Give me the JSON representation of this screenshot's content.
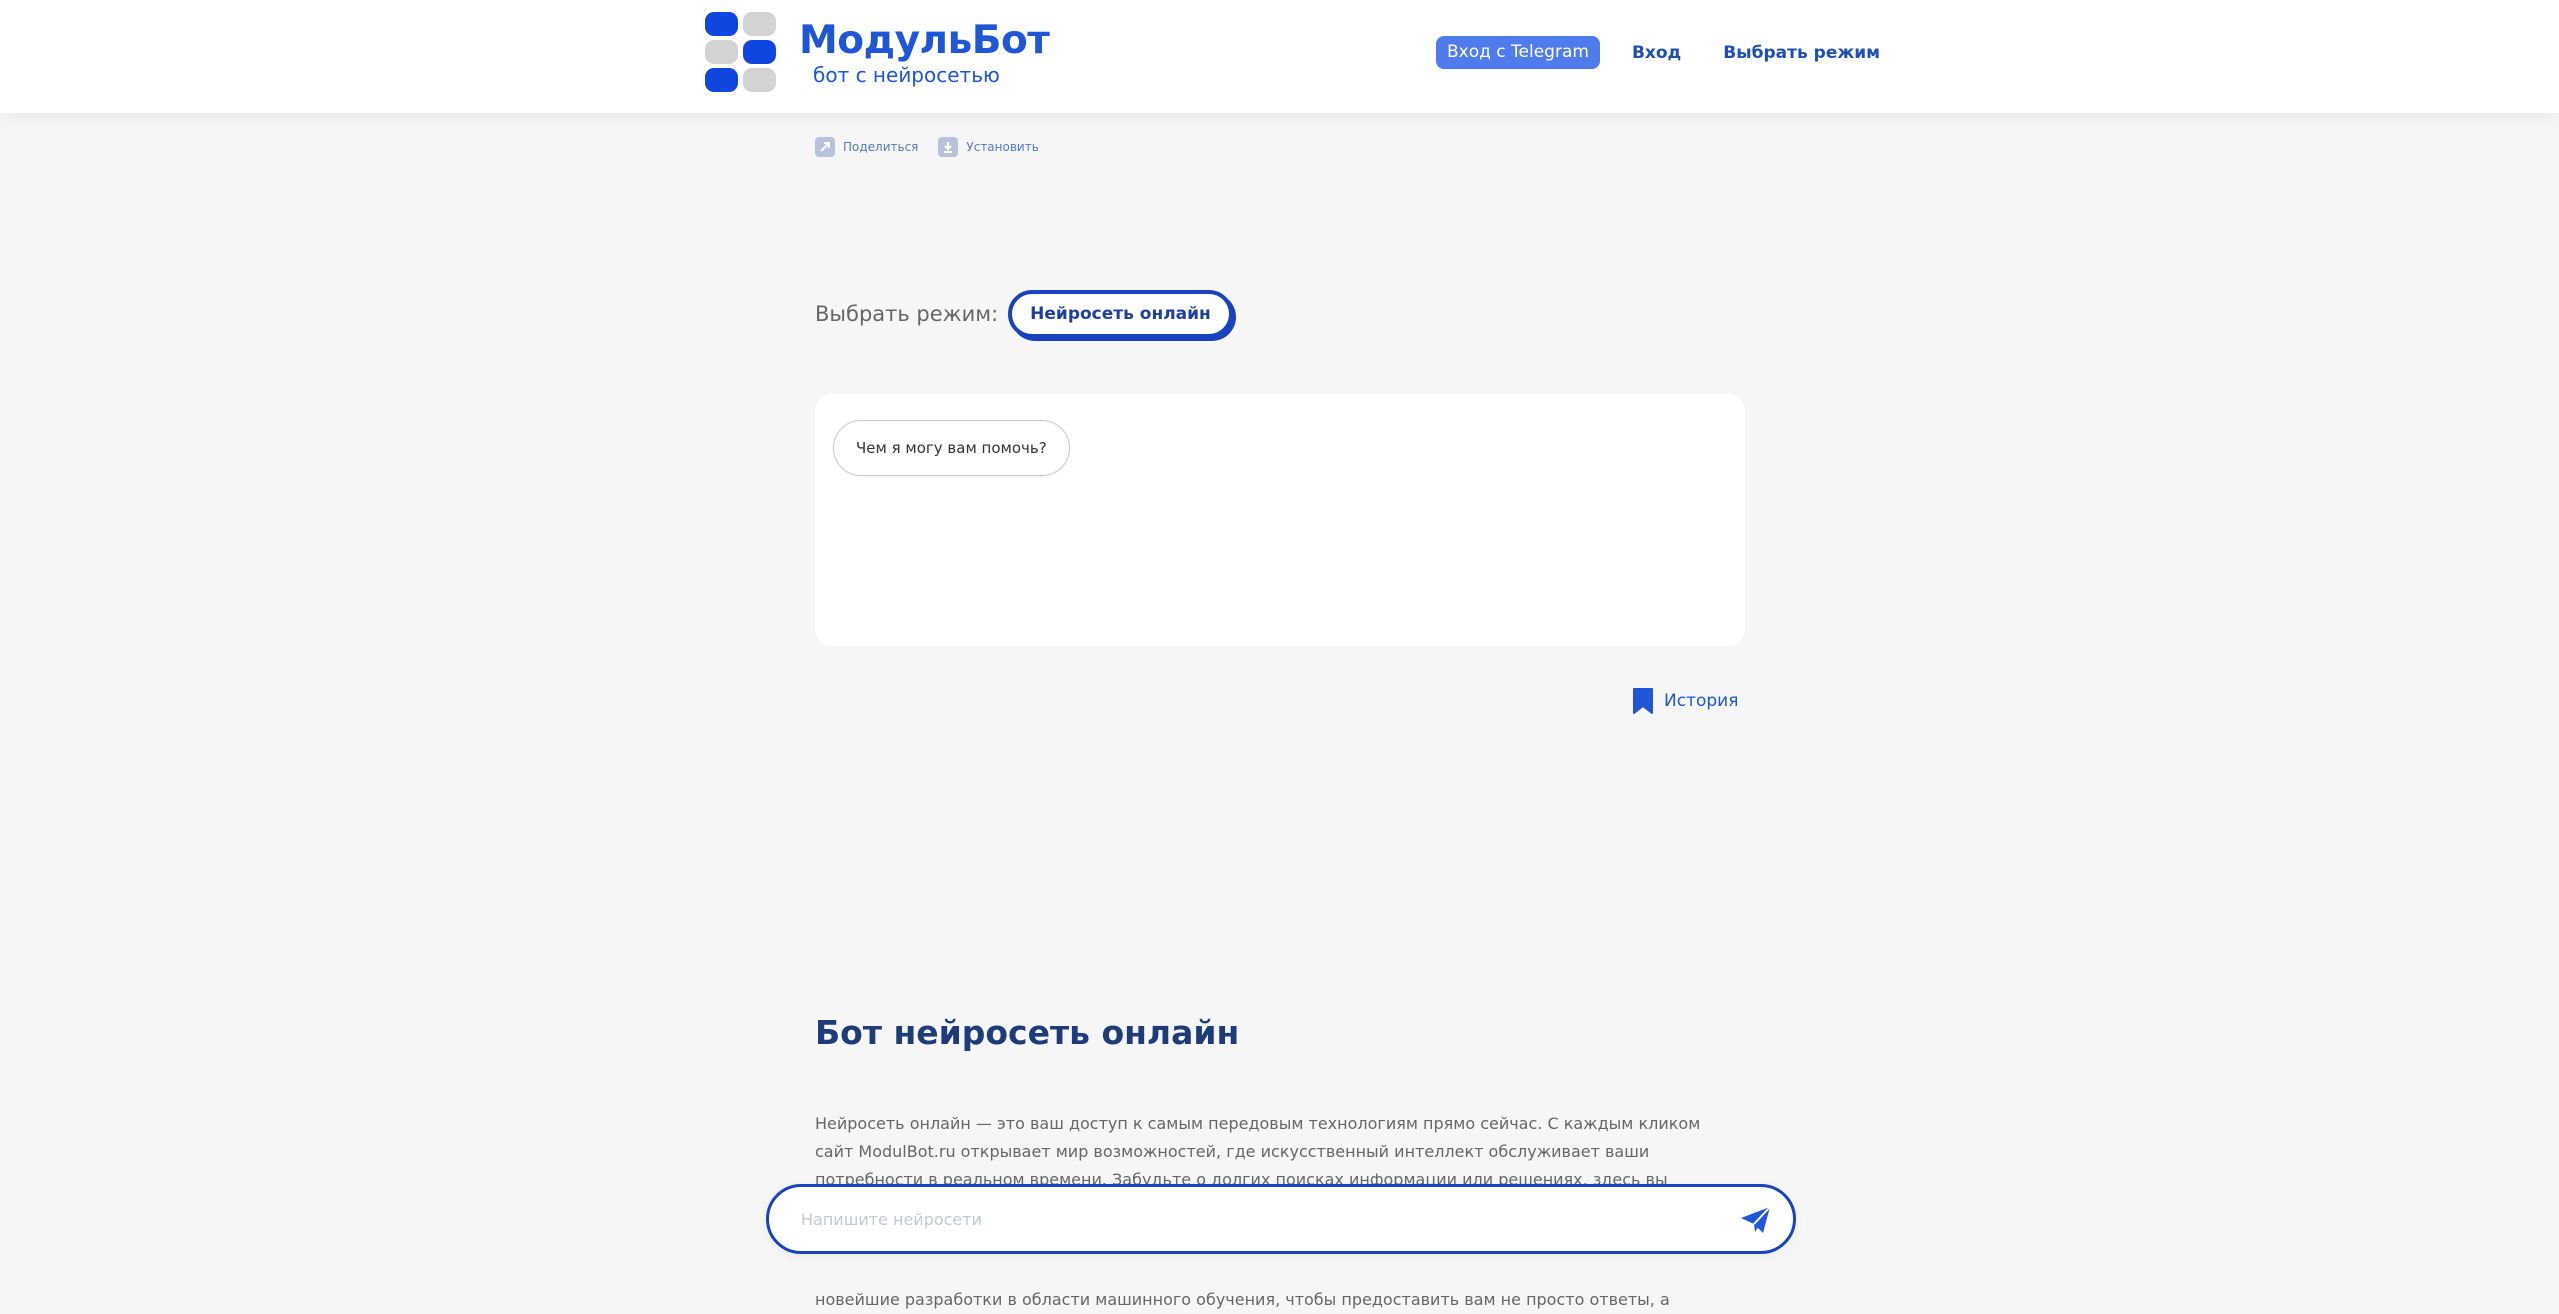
{
  "header": {
    "logo_title": "МодульБот",
    "logo_subtitle": "бот с нейросетью",
    "telegram_login": "Вход с Telegram",
    "login": "Вход",
    "choose_mode": "Выбрать режим"
  },
  "actions": {
    "share": "Поделиться",
    "install": "Установить"
  },
  "mode": {
    "label": "Выбрать режим:",
    "selected": "Нейросеть онлайн"
  },
  "chat": {
    "greeting": "Чем я могу вам помочь?"
  },
  "history": {
    "label": "История"
  },
  "article": {
    "title": "Бот нейросеть онлайн",
    "paragraph1": "Нейросеть онлайн — это ваш доступ к самым передовым технологиям прямо сейчас. С каждым кликом сайт ModulBot.ru открывает мир возможностей, где искусственный интеллект обслуживает ваши потребности в реальном времени. Забудьте о долгих поисках информации или решениях, здесь вы найдете все необходимое",
    "paragraph2": "новейшие разработки в области машинного обучения, чтобы предоставить вам не просто ответы, а"
  },
  "input": {
    "placeholder": "Напишите нейросети"
  },
  "colors": {
    "brand": "#1f56d8",
    "accent": "#4f7bec",
    "outline": "#1941c0",
    "background": "#f6f6f6"
  }
}
